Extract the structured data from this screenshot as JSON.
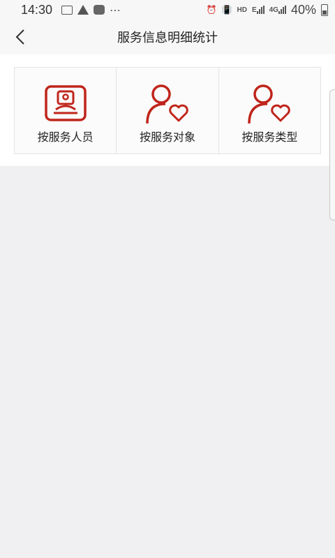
{
  "status_bar": {
    "time": "14:30",
    "hd_label": "HD",
    "e_label": "E",
    "g4_label": "4G",
    "battery": "40%"
  },
  "nav": {
    "back_icon": "chevron-left-icon",
    "title": "服务信息明细统计"
  },
  "menu": {
    "items": [
      {
        "label": "按服务人员",
        "icon": "staff-badge-icon"
      },
      {
        "label": "按服务对象",
        "icon": "person-heart-icon"
      },
      {
        "label": "按服务类型",
        "icon": "person-heart-icon"
      }
    ]
  },
  "colors": {
    "accent": "#c0251b",
    "background": "#f0f0f2",
    "panel": "#ffffff"
  }
}
